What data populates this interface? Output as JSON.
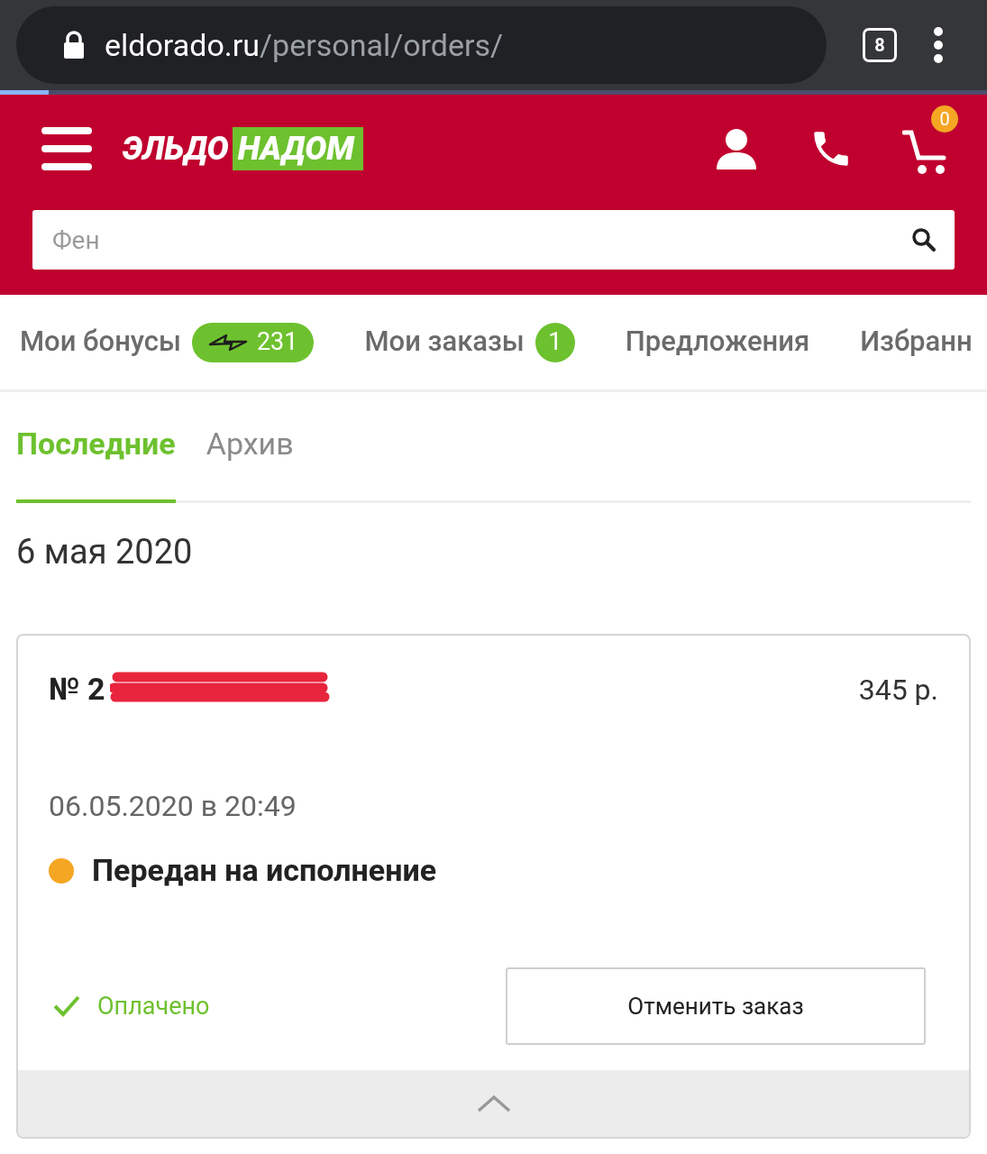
{
  "browser": {
    "url_host": "eldorado.ru",
    "url_path": "/personal/orders/",
    "tab_count": "8"
  },
  "header": {
    "logo": [
      "ЭЛЬДО",
      "НАДОМ"
    ],
    "cart_count": "0",
    "search": {
      "placeholder": "Фен"
    }
  },
  "nav": [
    {
      "label": "Мои бонусы",
      "badge": "231",
      "kind": "bonus"
    },
    {
      "label": "Мои заказы",
      "badge": "1",
      "kind": "count"
    },
    {
      "label": "Предложения",
      "kind": "plain"
    },
    {
      "label": "Избранн",
      "kind": "plain"
    }
  ],
  "tabs": [
    {
      "label": "Последние",
      "selected": true
    },
    {
      "label": "Архив",
      "selected": false
    }
  ],
  "date": "6 мая 2020",
  "order": {
    "number": "№ 2",
    "price": "345 р.",
    "datetime": "06.05.2020 в 20:49",
    "status": {
      "label": "Передан на исполнение",
      "color": "#f5a623"
    },
    "payment": {
      "label": "Оплачено",
      "paid": true
    },
    "cancel_button": "Отменить заказ"
  }
}
